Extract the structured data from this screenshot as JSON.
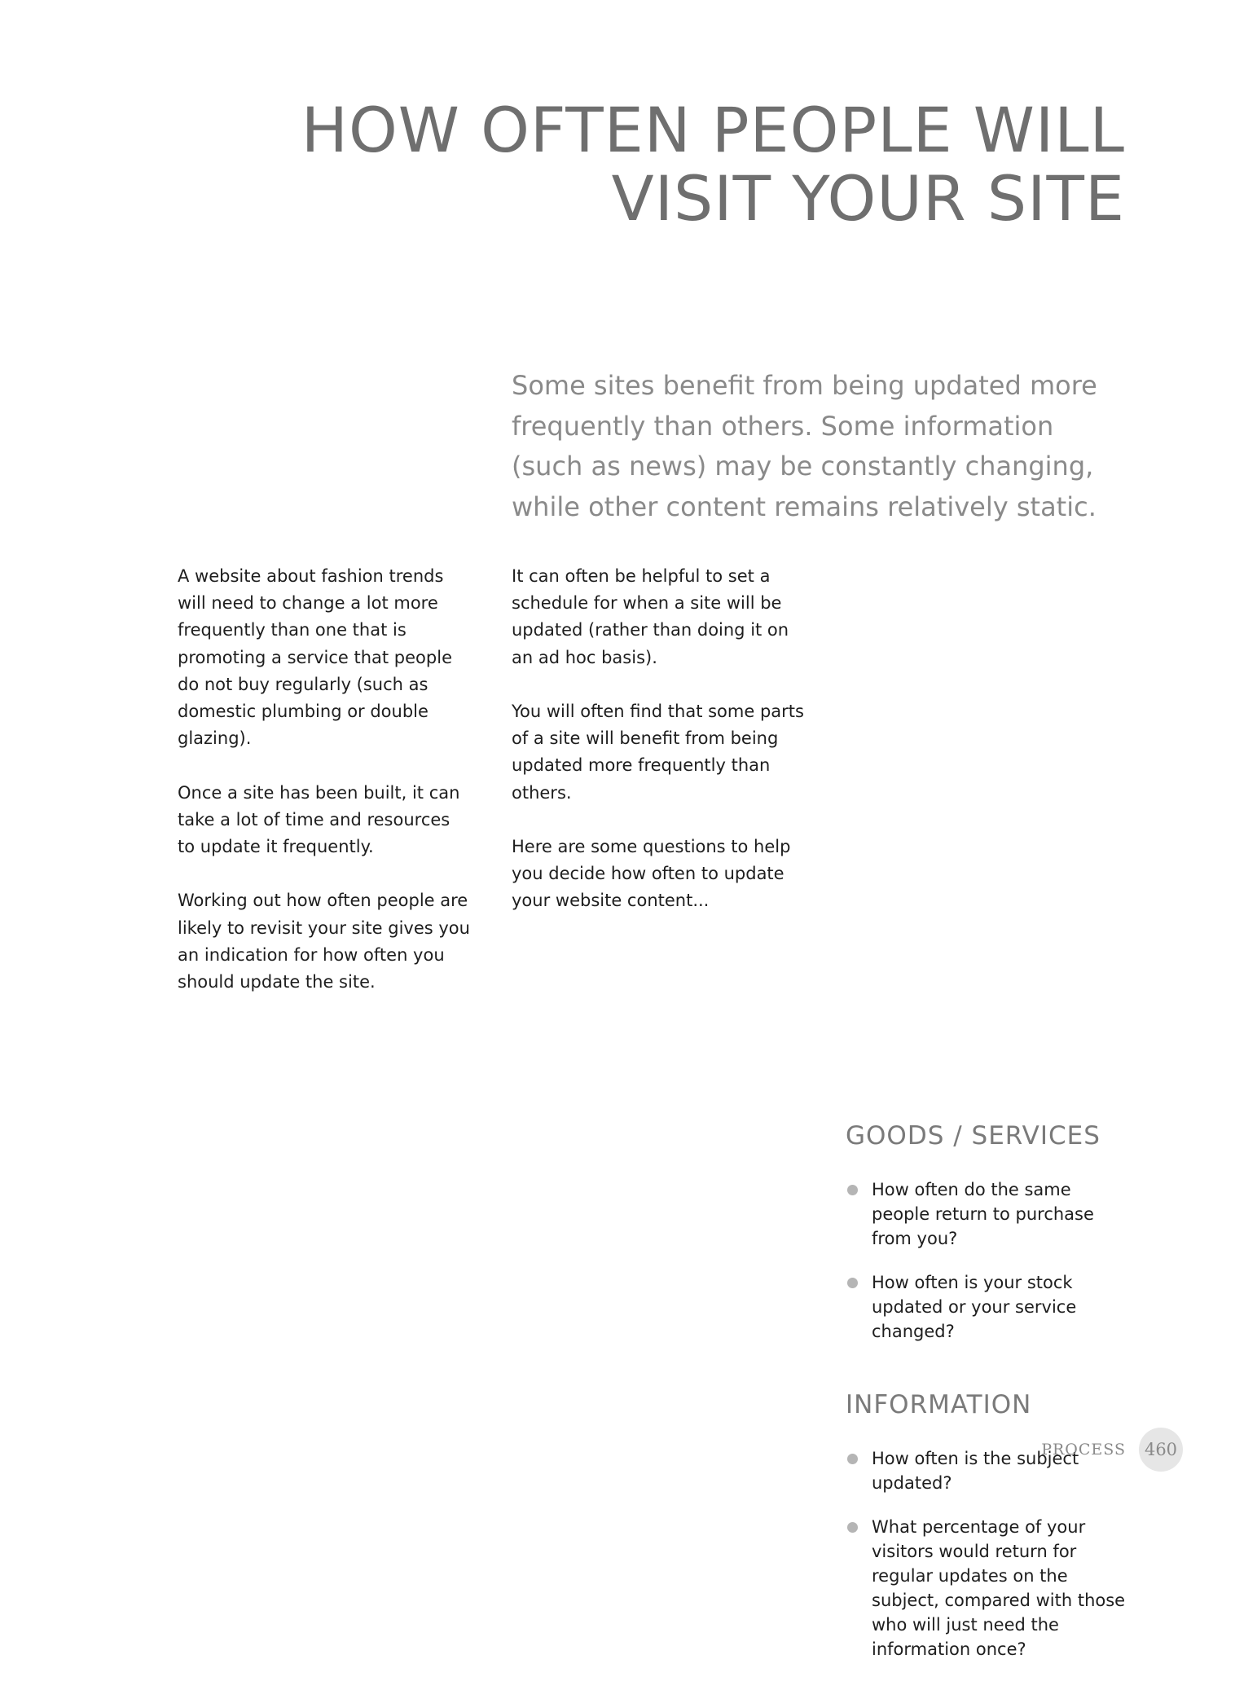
{
  "title": {
    "line1": "HOW OFTEN PEOPLE WILL",
    "line2": "VISIT YOUR SITE"
  },
  "intro": "Some sites benefit from being updated more frequently than others. Some information (such as news) may be constantly changing, while other content remains relatively static.",
  "column1": [
    "A website about fashion trends will need to change a lot more frequently than one that is promoting a service that people do not buy regularly (such as domestic plumbing or double glazing).",
    "Once a site has been built, it can take a lot of time and resources to update it frequently.",
    "Working out how often people are likely to revisit your site gives you an indication for how often you should update the site."
  ],
  "column2": [
    "It can often be helpful to set a schedule for when a site will be updated (rather than doing it on an ad hoc basis).",
    "You will often find that some parts of a site will benefit from being updated more frequently than others.",
    "Here are some questions to help you decide how often to update your website content..."
  ],
  "goods_services": {
    "heading": "GOODS / SERVICES",
    "items": [
      "How often do the same people return to purchase from you?",
      "How often is your stock updated or your service changed?"
    ]
  },
  "information": {
    "heading": "INFORMATION",
    "items": [
      "How often is the subject updated?",
      "What percentage of your visitors would return for regular updates on the subject, compared with those who will just need the information once?"
    ]
  },
  "footer": {
    "section": "PROCESS",
    "page_number": "460"
  }
}
